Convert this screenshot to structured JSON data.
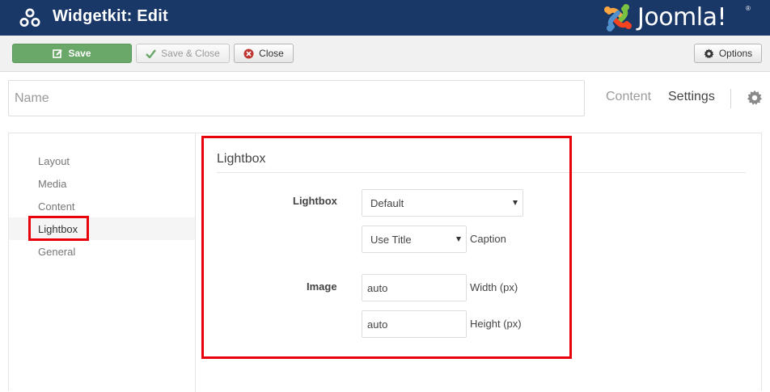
{
  "header": {
    "title": "Widgetkit: Edit",
    "brand": "Joomla!",
    "brand_reg": "®",
    "bg_color": "#1a3867"
  },
  "toolbar": {
    "save_label": "Save",
    "save_close_label": "Save & Close",
    "close_label": "Close",
    "options_label": "Options",
    "save_color": "#6aa86a"
  },
  "name": {
    "placeholder": "Name"
  },
  "top_tabs": {
    "content": "Content",
    "settings": "Settings"
  },
  "sidebar": {
    "items": [
      {
        "label": "Layout"
      },
      {
        "label": "Media"
      },
      {
        "label": "Content"
      },
      {
        "label": "Lightbox"
      },
      {
        "label": "General"
      }
    ],
    "active": "Lightbox"
  },
  "form": {
    "section_title": "Lightbox",
    "lightbox_label": "Lightbox",
    "lightbox_select": "Default",
    "caption_select": "Use Title",
    "caption_label": "Caption",
    "image_label": "Image",
    "width_value": "auto",
    "width_label": "Width (px)",
    "height_value": "auto",
    "height_label": "Height (px)"
  },
  "highlight_color": "#e8000b",
  "icons": [
    "widgetkit-icon",
    "joomla-logo-icon",
    "check-icon",
    "check-icon",
    "close-circle-icon",
    "gear-icon",
    "gear-icon"
  ]
}
